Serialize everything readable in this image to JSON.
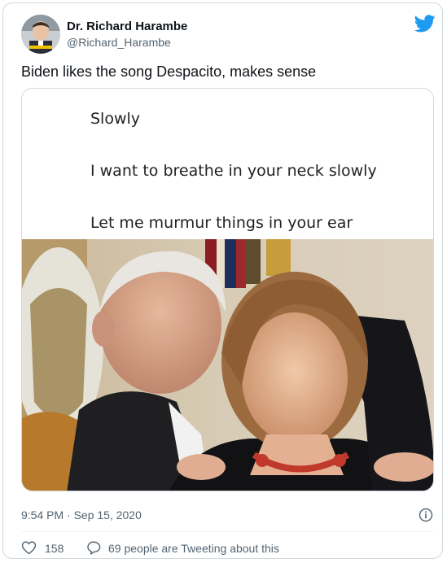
{
  "author": {
    "name": "Dr. Richard Harambe",
    "handle": "@Richard_Harambe"
  },
  "tweet": {
    "text": "Biden likes the song Despacito, makes sense",
    "media_lines": [
      "Slowly",
      "I want to breathe in your neck slowly",
      "Let me murmur things in your ear"
    ],
    "timestamp": "9:54 PM · Sep 15, 2020"
  },
  "actions": {
    "like_count": "158",
    "reply_text": "69 people are Tweeting about this"
  },
  "colors": {
    "brand": "#1d9bf0",
    "like_red": "#f91880",
    "muted": "#536471",
    "border": "#cfd9de"
  },
  "icons": [
    "twitter-bird-icon",
    "info-icon",
    "heart-icon",
    "speech-bubble-icon"
  ]
}
